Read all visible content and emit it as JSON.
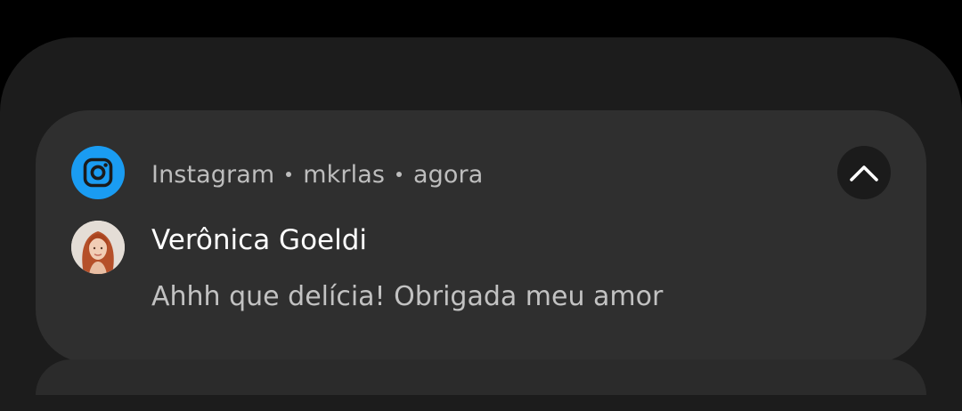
{
  "notification": {
    "app_name": "Instagram",
    "account": "mkrlas",
    "time": "agora",
    "sender": "Verônica Goeldi",
    "message": "Ahhh que delícia! Obrigada meu amor",
    "app_icon": "instagram-icon",
    "collapse_icon": "chevron-up-icon"
  },
  "colors": {
    "background": "#000000",
    "shade": "#1c1c1c",
    "card": "#2f2f2f",
    "app_icon_bg": "#1a9cf2",
    "collapse_bg": "#1b1b1b",
    "sender_text": "#ffffff",
    "secondary_text": "#bdbdbd"
  }
}
